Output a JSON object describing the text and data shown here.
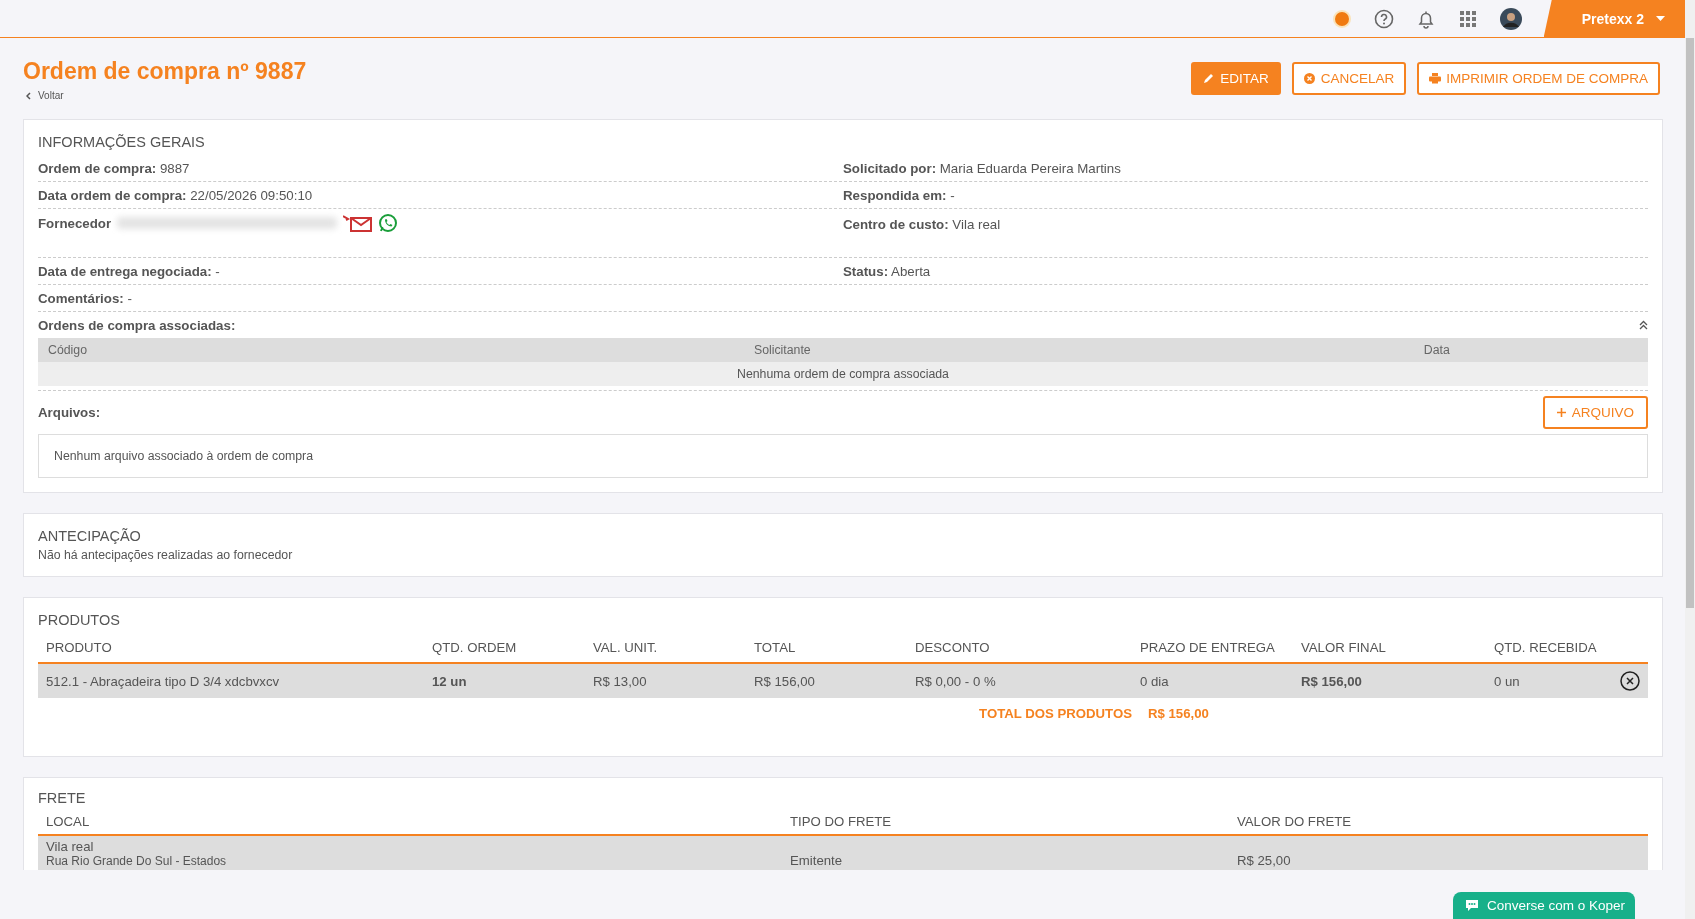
{
  "topbar": {
    "company": "Pretexx 2"
  },
  "header": {
    "title": "Ordem de compra nº 9887",
    "back": "Voltar",
    "buttons": [
      {
        "label": "EDITAR",
        "kind": "edit"
      },
      {
        "label": "CANCELAR",
        "kind": "cancel"
      },
      {
        "label": "IMPRIMIR ORDEM DE COMPRA",
        "kind": "print"
      }
    ]
  },
  "general": {
    "title": "INFORMAÇÕES GERAIS",
    "rows": [
      [
        {
          "label": "Ordem de compra:",
          "value": "9887"
        },
        {
          "label": "Solicitado por:",
          "value": "Maria Eduarda Pereira Martins"
        }
      ],
      [
        {
          "label": "Data ordem de compra:",
          "value": "22/05/2026 09:50:10"
        },
        {
          "label": "Respondida em:",
          "value": "-"
        }
      ],
      [
        {
          "label": "Fornecedor",
          "kind": "supplier"
        },
        {
          "label": "Centro de custo:",
          "value": "Vila real"
        }
      ],
      [
        {
          "label": "Data de entrega negociada:",
          "value": "-"
        },
        {
          "label": "Status:",
          "value": "Aberta"
        }
      ],
      [
        {
          "label": "Comentários:",
          "value": "-"
        }
      ]
    ],
    "associated": {
      "label": "Ordens de compra associadas:",
      "expanded": true,
      "columns": [
        "Código",
        "Solicitante",
        "Data"
      ],
      "empty": "Nenhuma ordem de compra associada"
    },
    "files": {
      "label": "Arquivos:",
      "button": "ARQUIVO",
      "empty": "Nenhum arquivo associado à ordem de compra"
    }
  },
  "anticipation": {
    "title": "ANTECIPAÇÃO",
    "text": "Não há antecipações realizadas ao fornecedor"
  },
  "products": {
    "title": "PRODUTOS",
    "columns": [
      "PRODUTO",
      "QTD. ORDEM",
      "VAL. UNIT.",
      "TOTAL",
      "DESCONTO",
      "PRAZO DE ENTREGA",
      "VALOR FINAL",
      "QTD. RECEBIDA"
    ],
    "rows": [
      {
        "cells": [
          "512.1 - Abraçadeira tipo D 3/4 xdcbvxcv",
          "12 un",
          "R$ 13,00",
          "R$ 156,00",
          "R$ 0,00 - 0 %",
          "0 dia",
          "R$ 156,00",
          "0 un"
        ]
      }
    ],
    "total_label": "TOTAL DOS PRODUTOS",
    "total": "R$ 156,00"
  },
  "freight": {
    "title": "FRETE",
    "columns": [
      "LOCAL",
      "TIPO DO FRETE",
      "VALOR DO FRETE"
    ],
    "rows": [
      {
        "local": "Vila real",
        "address": "Rua Rio Grande Do Sul - Estados",
        "type": "Emitente",
        "value": "R$ 25,00"
      }
    ]
  },
  "chat": {
    "label": "Converse com o Koper"
  }
}
